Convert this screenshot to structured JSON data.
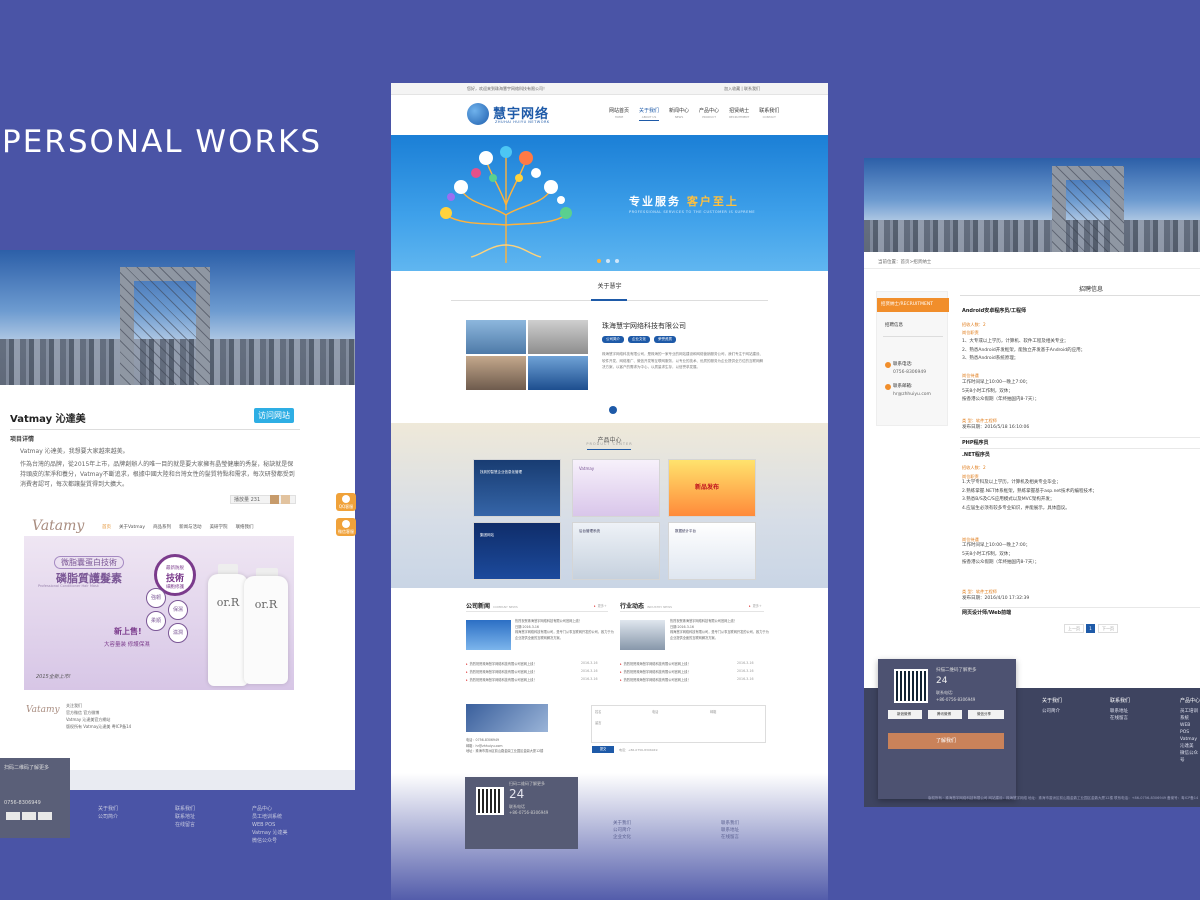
{
  "heading": "PERSONAL WORKS",
  "left": {
    "title": "Vatmay 沁達美",
    "visit_button": "访问网站",
    "subtitle": "项目详情",
    "intro": "Vatmay 沁達美，我想要大家越來越美。",
    "paragraph": "作為台灣的品牌，從2015年上市，品牌創辦人的唯一目的就是要大家擁有晶瑩健康的秀髮，秘訣就是保持頭皮的潔淨和養分，Vatmay不斷追求，根據中國大陸和台灣女性的髮質特點和需求，每次研發都受到消費者認可，每次都讓髮質得到大擴大。",
    "share_label": "播放量 231",
    "site": {
      "logo": "Vatamy",
      "nav": [
        "首页",
        "关于Vatmay",
        "商品系列",
        "新闻与活动",
        "美研学院",
        "联络我们"
      ],
      "banner_pill": "微脂囊蛋白技術",
      "banner_main": "磷脂質護髮素",
      "banner_en": "Professional Conditioner Hair Mask",
      "badge_top": "最新防脱",
      "badge_mid": "技術",
      "badge_bot": "細胞修護",
      "circles": [
        "強韌",
        "柔順",
        "保濕",
        "滋潤"
      ],
      "new_text": "新上售!",
      "new_sub": "大容量装  修護保濕",
      "launch": "2015全新上市!",
      "bottle_labels": [
        "or.R",
        "or.R"
      ]
    },
    "footer_logo": "Vatamy",
    "footer_text": [
      "关注我们",
      "官方微信  官方微博",
      "Vatmay  沁達美官方網站",
      "版权所有 Vatmay沁達美  粤ICP备14"
    ],
    "dark_card": {
      "title": "扫码二维码了解更多",
      "phone": "0756-8306949"
    },
    "footer_cols": [
      {
        "head": "关于我们",
        "items": [
          "公司简介"
        ]
      },
      {
        "head": "联系我们",
        "items": [
          "联系地址",
          "在线留言"
        ]
      },
      {
        "head": "产品中心",
        "items": [
          "员工培训系统",
          "WEB POS",
          "Vatmay 沁達美",
          "微信公众号"
        ]
      }
    ],
    "side_float": [
      "QQ客服",
      "微信客服"
    ]
  },
  "mid": {
    "topbar_left": "您好，欢迎来到珠海慧宇网络科技有限公司！",
    "topbar_right": "加入收藏  |  联系我们",
    "logo": "慧宇网络",
    "logo_sub": "ZHUHAI HUIYU NETWORK",
    "nav": [
      {
        "label": "网站首页",
        "en": "HOME"
      },
      {
        "label": "关于我们",
        "en": "ABOUT US"
      },
      {
        "label": "新闻中心",
        "en": "NEWS"
      },
      {
        "label": "产品中心",
        "en": "PRODUCT"
      },
      {
        "label": "招贤纳士",
        "en": "RECRUITMENT"
      },
      {
        "label": "联系我们",
        "en": "CONTACT"
      }
    ],
    "slogan_a": "专业服务  ",
    "slogan_b": "客户至上",
    "slogan_en": "PROFESSIONAL SERVICES TO THE CUSTOMER IS SUPREME",
    "about_title": "关于慧宇",
    "company": "珠海慧宇网络科技有限公司",
    "tags": [
      "公司简介",
      "企业文化",
      "荣誉资质"
    ],
    "about_desc": "珠海慧宇网络科技有限公司，是珠海的一家专业的网站建设和网络营销服务公司，我们专注于网站建设、软件开发、网络推广、微信开发等互联网服务，以专业的技术、优质的服务为企业提供全方位的互联网解决方案，以客户的需求为中心，以质量求生存，以信誉求发展。",
    "products_title": "产品中心",
    "products_en": "PRODUCT CENTER",
    "product_thumbs": [
      "找到的智慧企业信息化管理",
      "Vatmay",
      "新品发布",
      "集团网站",
      "后台管理系统",
      "数据统计平台"
    ],
    "news": [
      {
        "head": "公司新闻",
        "en": "COMPANY NEWS",
        "more": "更多+",
        "lead_title": "热烈祝贺珠海慧宇网络科技有限公司官网上线！",
        "lead_date": "日期:2016-3-16",
        "lead_text": "珠海慧宇网络科技有限公司，是专门从事互联网开发的公司，致力于为企业提供全面的互联网解决方案。",
        "items": [
          "热烈祝贺珠海慧宇网络科技有限公司官网上线！",
          "热烈祝贺珠海慧宇网络科技有限公司官网上线！",
          "热烈祝贺珠海慧宇网络科技有限公司官网上线！"
        ],
        "dates": [
          "2016-3-16",
          "2016-3-16",
          "2016-3-16"
        ]
      },
      {
        "head": "行业动态",
        "en": "INDUSTRY NEWS",
        "more": "更多+",
        "lead_title": "热烈祝贺珠海慧宇网络科技有限公司官网上线！",
        "lead_date": "日期:2016-3-16",
        "lead_text": "珠海慧宇网络科技有限公司，是专门从事互联网开发的公司，致力于为企业提供全面的互联网解决方案。",
        "items": [
          "热烈祝贺珠海慧宇网络科技有限公司官网上线！",
          "热烈祝贺珠海慧宇网络科技有限公司官网上线！",
          "热烈祝贺珠海慧宇网络科技有限公司官网上线！"
        ],
        "dates": [
          "2016-3-16",
          "2016-3-16",
          "2016-3-16"
        ]
      }
    ],
    "contact_text": [
      "电话：0756-8306949",
      "邮箱：hr@zhhuiyu.com",
      "地址：珠海市香洲区前山路金鼎工业园区金鼎大厦12楼"
    ],
    "form_labels": [
      "姓名",
      "电话",
      "邮箱",
      "留言"
    ],
    "submit": "提交",
    "submit_note": "电话：+86-0756-8306949",
    "dark_card": {
      "title": "扫码二维码了解更多",
      "num": "24",
      "sub": "联系电话",
      "phone": "+86-0756-8306949"
    },
    "footer_cols": [
      {
        "head": "关于我们",
        "items": [
          "公司简介",
          "企业文化"
        ]
      },
      {
        "head": "联系我们",
        "items": [
          "联系地址",
          "在线留言"
        ]
      }
    ]
  },
  "right": {
    "crumb": "当前位置：首页>招贤纳士",
    "side_head": "招贤纳士/RECRUITMENT",
    "side_item": "招聘信息",
    "hotline_label": "联系电话:",
    "hotline": "0756-8306949",
    "email_label": "联系邮箱:",
    "email": "hr@zhhuiyu.com",
    "title": "招聘信息",
    "jobs": [
      {
        "name": "Android安卓程序员/工程师",
        "count_label": "招收人数：2",
        "req_label": "岗位职责",
        "reqs": [
          "1、大专或以上学历，计算机、软件工程及相关专业；",
          "2、熟悉Android开发框架，能独立开发基于Android的应用；",
          "3、熟悉Android系统原理；"
        ],
        "treat_label": "岗位待遇",
        "treats": [
          "工作时间早上10:00—晚上7:00；",
          "5天8小时工作制，双休；",
          "按香港公众假期（年终抽国内8-7天）；"
        ],
        "type": "类  型：软件工程师",
        "date": "发布日期：2016/5/18 16:10:06"
      },
      {
        "name": "PHP程序员"
      },
      {
        "name": ".NET程序员",
        "count_label": "招收人数：2",
        "req_label": "岗位职责",
        "reqs": [
          "1.大学专科及以上学历，计算机及相关专业毕业；",
          "2.熟练掌握.NET体系框架，熟练掌握基于asp.net技术的编程技术；",
          "3.熟悉B/S及C/S应用模式以及MVC架构开发；",
          "4.应届生必须有较多专业知识，并能展示，具体面议。"
        ],
        "treat_label": "岗位待遇",
        "treats": [
          "工作时间早上10:00—晚上7:00；",
          "5天8小时工作制，双休；",
          "按香港公众假期（年终抽国内8-7天）；"
        ],
        "type": "类  型：软件工程师",
        "date": "发布日期：2016/4/10 17:32:39"
      },
      {
        "name": "网页设计师/Web前端"
      }
    ],
    "pager": [
      "上一页",
      "1",
      "下一页"
    ],
    "card": {
      "title": "扫描二维码了解更多",
      "num": "24",
      "sub": "联系电话:",
      "phone": "+86-0756-8306949"
    },
    "share": [
      "新浪微博",
      "腾讯微博",
      "微信分享"
    ],
    "understand_btn": "了解我们",
    "footer_cols": [
      {
        "head": "关于我们",
        "items": [
          "公司简介"
        ]
      },
      {
        "head": "联系我们",
        "items": [
          "联系地址",
          "在线留言"
        ]
      },
      {
        "head": "产品中心",
        "items": [
          "员工培训系统",
          "WEB POS",
          "Vatmay 沁達美",
          "微信公众号"
        ]
      }
    ],
    "copyright": "版权所有 · 珠海慧宇网络科技有限公司 网站建设：珠海慧宇网络   地址：珠海市香洲区前山路金鼎工业园区金鼎大厦12楼 联系电话：+86-0756-8306949 备案号：粤ICP备14"
  }
}
